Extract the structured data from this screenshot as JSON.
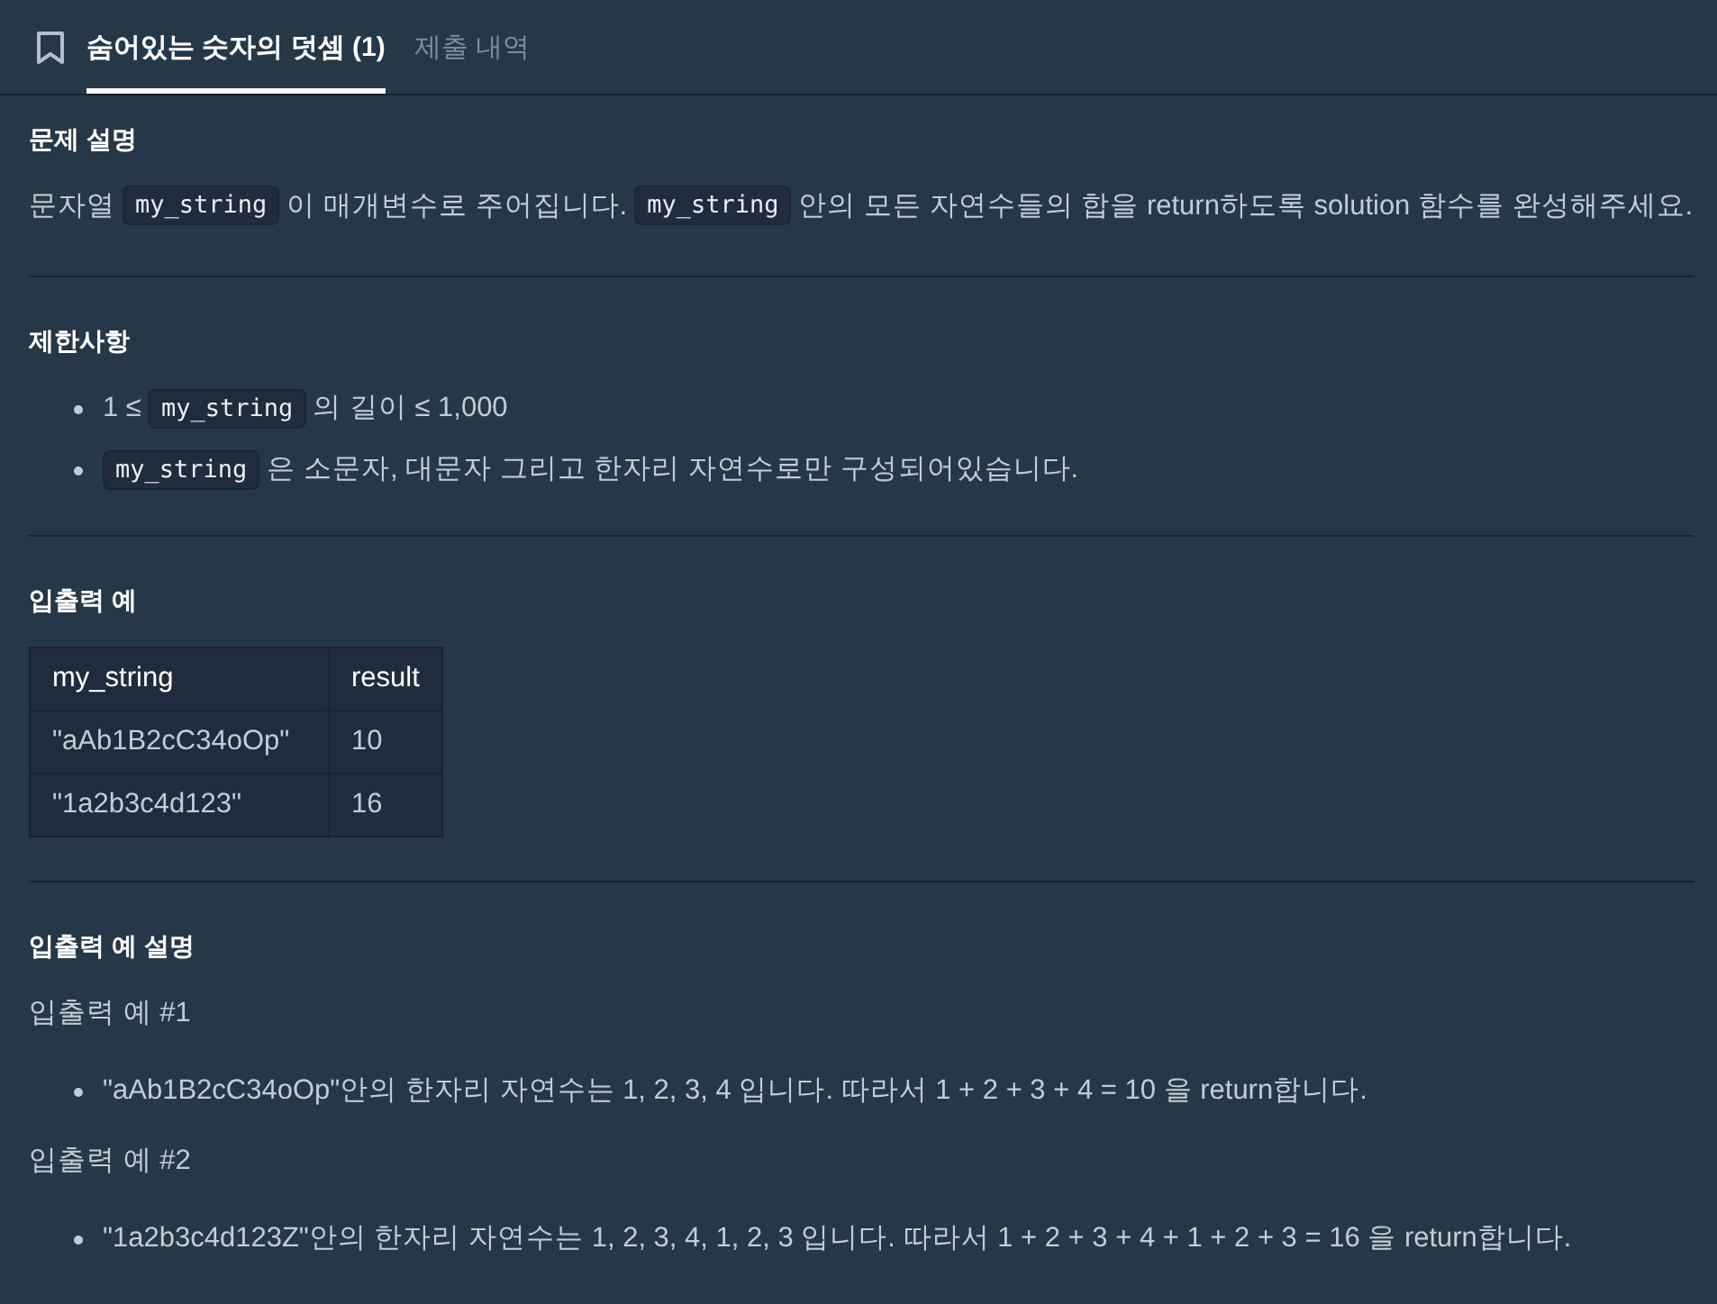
{
  "tabs": [
    {
      "label": "숨어있는 숫자의 덧셈 (1)",
      "selected": true
    },
    {
      "label": "제출 내역",
      "selected": false
    }
  ],
  "sections": [
    {
      "kind": "paragraph",
      "heading": "문제 설명",
      "segments": [
        {
          "kind": "text",
          "text": "문자열"
        },
        {
          "kind": "code",
          "text": "my_string"
        },
        {
          "kind": "text",
          "text": "이 매개변수로 주어집니다."
        },
        {
          "kind": "code",
          "text": "my_string"
        },
        {
          "kind": "text",
          "text": "안의 모든 자연수들의 합을 return하도록 solution 함수를 완성해주세요."
        }
      ]
    },
    {
      "kind": "list",
      "heading": "제한사항",
      "items": [
        [
          {
            "kind": "text",
            "text": "1 ≤"
          },
          {
            "kind": "code",
            "text": "my_string"
          },
          {
            "kind": "text",
            "text": "의 길이 ≤ 1,000"
          }
        ],
        [
          {
            "kind": "code",
            "text": "my_string"
          },
          {
            "kind": "text",
            "text": "은 소문자, 대문자 그리고 한자리 자연수로만 구성되어있습니다."
          }
        ]
      ]
    },
    {
      "kind": "table",
      "heading": "입출력 예",
      "columns": [
        "my_string",
        "result"
      ],
      "rows": [
        [
          "\"aAb1B2cC34oOp\"",
          "10"
        ],
        [
          "\"1a2b3c4d123\"",
          "16"
        ]
      ]
    },
    {
      "kind": "examples",
      "heading": "입출력 예 설명",
      "examples": [
        {
          "title": "입출력 예 #1",
          "bullets": [
            "\"aAb1B2cC34oOp\"안의 한자리 자연수는 1, 2, 3, 4 입니다. 따라서 1 + 2 + 3 + 4 = 10 을 return합니다."
          ]
        },
        {
          "title": "입출력 예 #2",
          "bullets": [
            "\"1a2b3c4d123Z\"안의 한자리 자연수는 1, 2, 3, 4, 1, 2, 3 입니다. 따라서 1 + 2 + 3 + 4 + 1 + 2 + 3 = 16 을 return합니다."
          ]
        }
      ]
    }
  ]
}
